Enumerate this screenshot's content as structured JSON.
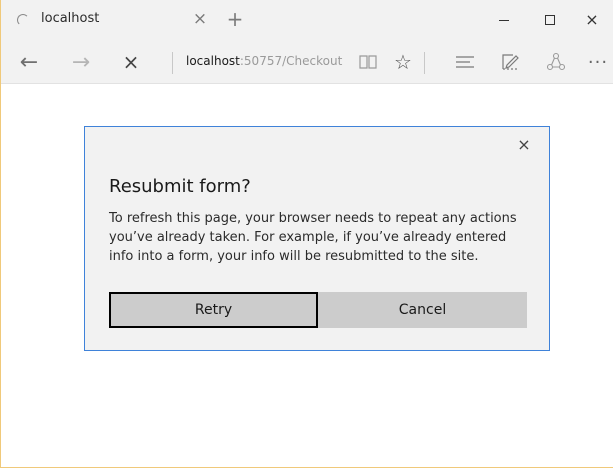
{
  "tab": {
    "title": "localhost",
    "close_glyph": "×",
    "new_tab_glyph": "+"
  },
  "window_controls": {
    "minimize_icon": "minimize-icon",
    "maximize_icon": "maximize-icon",
    "close_icon": "close-icon",
    "close_glyph": "×"
  },
  "toolbar": {
    "back_glyph": "←",
    "forward_glyph": "→",
    "stop_glyph": "×",
    "url_host": "localhost",
    "url_rest": ":50757/Checkout",
    "favorite_glyph": "☆",
    "more_glyph": "···",
    "icons": [
      "back-arrow-icon",
      "forward-arrow-icon",
      "stop-icon",
      "reading-view-icon",
      "star-icon",
      "hub-icon",
      "web-note-icon",
      "share-icon",
      "more-icon"
    ]
  },
  "dialog": {
    "close_glyph": "×",
    "title": "Resubmit form?",
    "message": "To refresh this page, your browser needs to repeat any actions you’ve already taken. For example, if you’ve already entered info into a form, your info will be resubmitted to the site.",
    "retry_label": "Retry",
    "cancel_label": "Cancel"
  },
  "colors": {
    "dialog_border": "#3f82d9",
    "chrome_bg": "#f2f2f2",
    "button_bg": "#cccccc"
  }
}
